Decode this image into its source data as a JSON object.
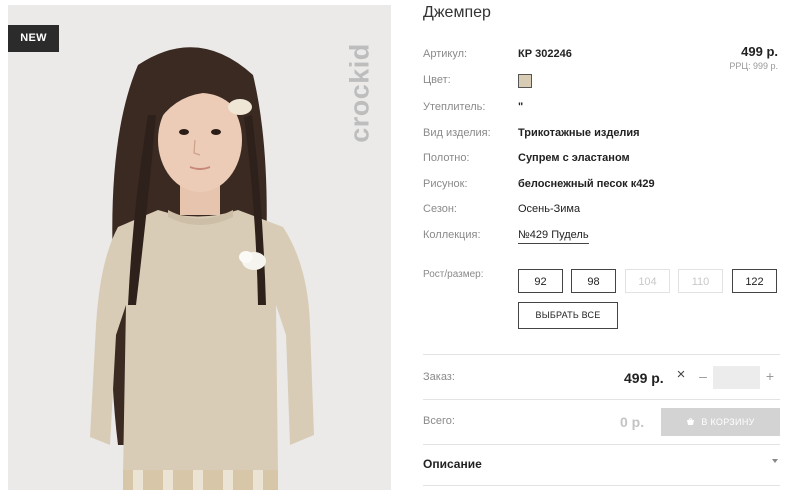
{
  "photo": {
    "badge": "NEW",
    "brand_logo": "crockid",
    "colors": {
      "background": "#ebeae9",
      "sweater": "#d9ccb6",
      "hair": "#3b2a22",
      "skin": "#e9c8b1"
    }
  },
  "product": {
    "title": "Джемпер",
    "price": "499 р.",
    "rrp": "РРЦ: 999 р."
  },
  "specs": [
    {
      "label": "Артикул:",
      "value": "КР 302246"
    },
    {
      "label": "Цвет:",
      "value": ""
    },
    {
      "label": "Утеплитель:",
      "value": "\""
    },
    {
      "label": "Вид изделия:",
      "value": "Трикотажные изделия"
    },
    {
      "label": "Полотно:",
      "value": "Супрем с эластаном"
    },
    {
      "label": "Рисунок:",
      "value": "белоснежный песок к429"
    },
    {
      "label": "Сезон:",
      "value": "Осень-Зима"
    },
    {
      "label": "Коллекция:",
      "value": "№429 Пудель"
    }
  ],
  "color_swatch": "#d9ccb4",
  "sizes": {
    "label": "Рост/размер:",
    "options": [
      {
        "value": "92",
        "available": true
      },
      {
        "value": "98",
        "available": true
      },
      {
        "value": "104",
        "available": false
      },
      {
        "value": "110",
        "available": false
      },
      {
        "value": "122",
        "available": true
      }
    ],
    "select_all": "ВЫБРАТЬ ВСЕ"
  },
  "order": {
    "label": "Заказ:",
    "price": "499 р.",
    "times_icon": "close-icon",
    "minus": "–",
    "quantity": "",
    "plus": "+"
  },
  "total": {
    "label": "Всего:",
    "value": "0 р.",
    "cart_button": "В КОРЗИНУ",
    "cart_icon": "basket-icon"
  },
  "description": {
    "label": "Описание"
  }
}
